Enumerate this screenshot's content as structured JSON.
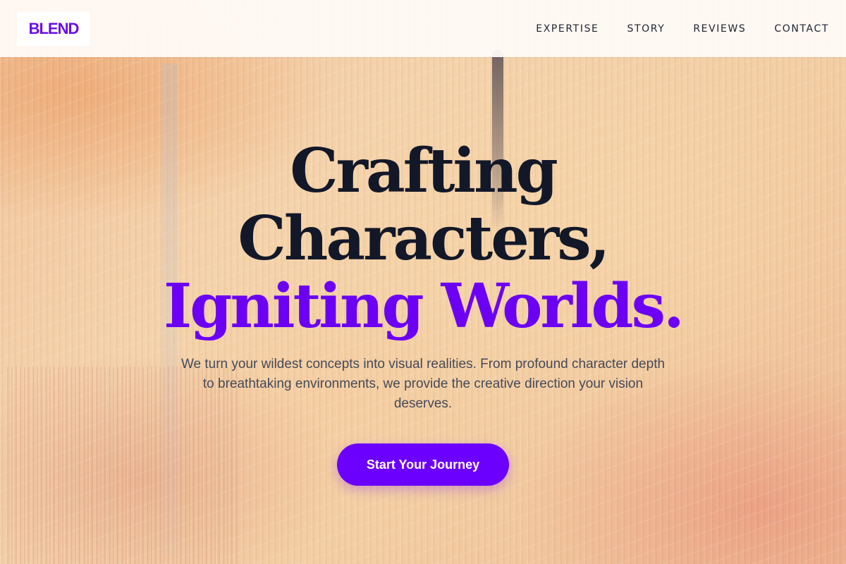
{
  "brand": {
    "logo": "BLEND",
    "accent": "#6c00ff"
  },
  "nav": {
    "items": [
      {
        "label": "EXPERTISE"
      },
      {
        "label": "STORY"
      },
      {
        "label": "REVIEWS"
      },
      {
        "label": "CONTACT"
      }
    ]
  },
  "hero": {
    "headline_line1": "Crafting",
    "headline_line2": "Characters,",
    "headline_line3": "Igniting Worlds.",
    "subtext": "We turn your wildest concepts into visual realities. From profound character depth to breathtaking environments, we provide the creative direction your vision deserves.",
    "cta_label": "Start Your Journey"
  },
  "colors": {
    "heading_dark": "#131828",
    "heading_accent": "#6b00f5",
    "body_text": "#454a58",
    "header_bg": "#fffbf8"
  }
}
